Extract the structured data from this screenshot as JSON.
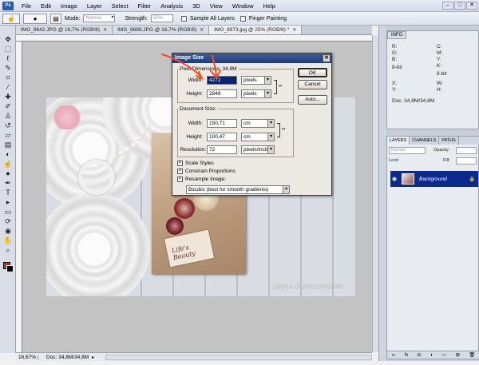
{
  "app": {
    "logo": "Ps"
  },
  "menubar": {
    "items": [
      "File",
      "Edit",
      "Image",
      "Layer",
      "Select",
      "Filter",
      "Analysis",
      "3D",
      "View",
      "Window",
      "Help"
    ],
    "window_controls": [
      "–",
      "□",
      "✕"
    ]
  },
  "options_bar": {
    "mode_label": "Mode:",
    "mode_value": "Normal",
    "strength_label": "Strength:",
    "strength_value": "50%",
    "sample_all_layers": "Sample All Layers",
    "finger_painting": "Finger Painting"
  },
  "doc_tabs": [
    {
      "label": "IMG_8642.JPG @ 16,7% (RGB/8)",
      "active": false
    },
    {
      "label": "IMG_8689.JPG @ 16,7% (RGB/8)",
      "active": false
    },
    {
      "label": "IMG_8973.jpg @ 25% (RGB/8) *",
      "active": true
    }
  ],
  "toolbox": {
    "tools": [
      {
        "name": "move-tool-icon",
        "glyph": "✥"
      },
      {
        "name": "marquee-tool-icon",
        "glyph": "⬚"
      },
      {
        "name": "lasso-tool-icon",
        "glyph": "ℓ"
      },
      {
        "name": "quick-select-tool-icon",
        "glyph": "✎"
      },
      {
        "name": "crop-tool-icon",
        "glyph": "⌗"
      },
      {
        "name": "eyedropper-tool-icon",
        "glyph": "⁄"
      },
      {
        "name": "healing-brush-tool-icon",
        "glyph": "✚"
      },
      {
        "name": "brush-tool-icon",
        "glyph": "✐"
      },
      {
        "name": "clone-stamp-tool-icon",
        "glyph": "♙"
      },
      {
        "name": "history-brush-tool-icon",
        "glyph": "↺"
      },
      {
        "name": "eraser-tool-icon",
        "glyph": "▱"
      },
      {
        "name": "gradient-tool-icon",
        "glyph": "▤"
      },
      {
        "name": "blur-tool-icon",
        "glyph": "◐"
      },
      {
        "name": "smudge-tool-icon",
        "glyph": "☝"
      },
      {
        "name": "dodge-tool-icon",
        "glyph": "●"
      },
      {
        "name": "pen-tool-icon",
        "glyph": "✒"
      },
      {
        "name": "type-tool-icon",
        "glyph": "T"
      },
      {
        "name": "path-select-tool-icon",
        "glyph": "▸"
      },
      {
        "name": "shape-tool-icon",
        "glyph": "▭"
      },
      {
        "name": "3d-rotate-tool-icon",
        "glyph": "⟳"
      },
      {
        "name": "3d-orbit-tool-icon",
        "glyph": "◉"
      },
      {
        "name": "hand-tool-icon",
        "glyph": "✋"
      },
      {
        "name": "zoom-tool-icon",
        "glyph": "⌕"
      }
    ],
    "foreground_color": "#e22a00",
    "background_color": "#000000"
  },
  "status_bar": {
    "zoom": "16,67%",
    "doc": "Doc: 34,8M/34,8M"
  },
  "photo": {
    "tag_text": "Life's Beauty",
    "signature": "Дарья Бурмистрова"
  },
  "info_panel": {
    "tab": "INFO",
    "cells": [
      "R:",
      "G:",
      "B:",
      "8-bit",
      "C:",
      "M:",
      "Y:",
      "K:",
      "8-bit",
      "X:",
      "Y:",
      "W:",
      "H:",
      "Doc: 34,8M/34,8M"
    ]
  },
  "layers_panel": {
    "tabs": [
      "LAYERS",
      "CHANNELS",
      "PATHS"
    ],
    "blend_mode": "Normal",
    "opacity_label": "Opacity:",
    "lock_label": "Lock:",
    "fill_label": "Fill:",
    "layer_name": "Background"
  },
  "dialog": {
    "title": "Image Size",
    "pixel_dimensions_legend": "Pixel Dimensions: 34,8M",
    "width_label": "Width:",
    "width_px": "4272",
    "height_label": "Height:",
    "height_px": "2848",
    "pixels_unit": "pixels",
    "document_size_legend": "Document Size:",
    "doc_width": "150,71",
    "doc_height": "100,47",
    "resolution_label": "Resolution:",
    "resolution": "72",
    "cm_unit": "cm",
    "res_unit": "pixels/inch",
    "ok": "OK",
    "cancel": "Cancel",
    "auto": "Auto...",
    "scale_styles": "Scale Styles",
    "constrain_proportions": "Constrain Proportions",
    "resample_image": "Resample Image:",
    "resample_method": "Bicubic (best for smooth gradients)"
  }
}
